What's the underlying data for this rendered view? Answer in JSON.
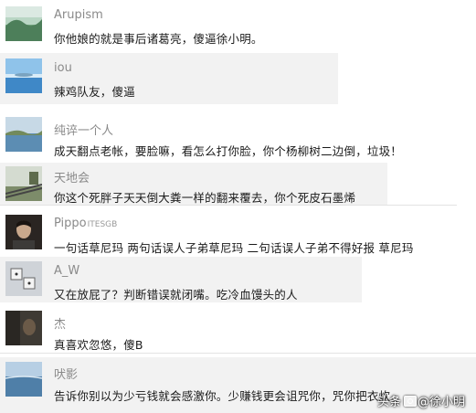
{
  "comments": [
    {
      "username": "Arupism",
      "text": "你他娘的就是事后诸葛亮，傻逼徐小明。",
      "avatar_icon": "landscape-avatar-icon"
    },
    {
      "username": "iou",
      "text": "辣鸡队友，傻逼",
      "avatar_icon": "sea-sky-avatar-icon"
    },
    {
      "username": "纯谇一个人",
      "text": "成天翻点老帐，要脸嘛，看怎么打你脸，你个杨柳树二边倒，垃圾！",
      "avatar_icon": "coast-avatar-icon"
    },
    {
      "username": "天地会",
      "text": "你这个死胖子天天倒大粪一样的翻来覆去，你个死皮石墨烯",
      "avatar_icon": "rail-avatar-icon"
    },
    {
      "username": "Pippo",
      "username_suffix": "ITESGB",
      "text": "一句话草尼玛 两句话误人子弟草尼玛 二句话误人子弟不得好报 草尼玛",
      "avatar_icon": "person-photo-avatar-icon"
    },
    {
      "username": "A_W",
      "text": "又在放屁了？判断错误就闭嘴。吃冷血馒头的人",
      "avatar_icon": "dice-avatar-icon"
    },
    {
      "username": "杰",
      "text": "真喜欢忽悠，傻B",
      "avatar_icon": "dark-photo-avatar-icon"
    },
    {
      "username": "吠影",
      "text": "告诉你别以为少亏钱就会感激你。少赚钱更会诅咒你，咒你把衣炊",
      "avatar_icon": "water-avatar-icon"
    }
  ],
  "watermark": {
    "prefix": "头条",
    "handle": "@徐小明"
  }
}
